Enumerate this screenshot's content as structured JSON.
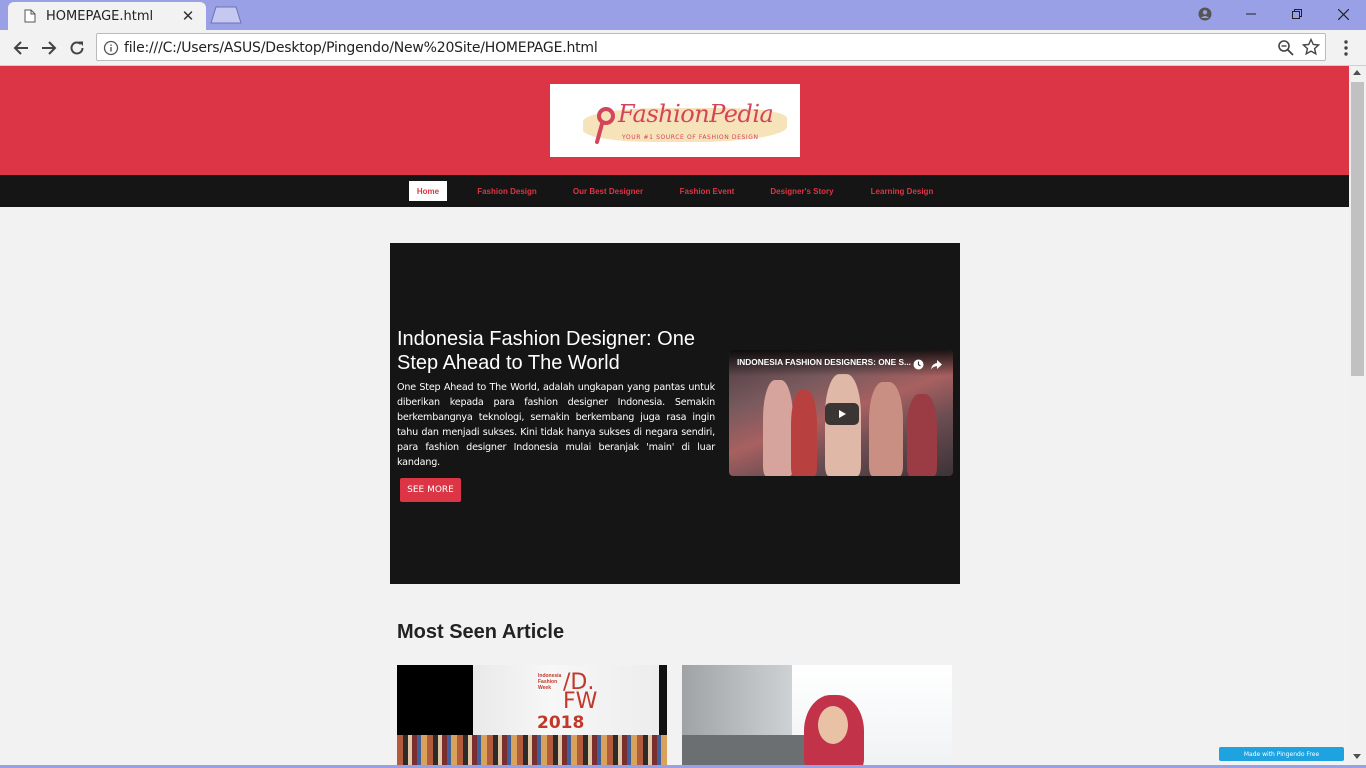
{
  "browser": {
    "tab_title": "HOMEPAGE.html",
    "url": "file:///C:/Users/ASUS/Desktop/Pingendo/New%20Site/HOMEPAGE.html"
  },
  "site": {
    "logo": {
      "name": "FashionPedia",
      "tagline": "YOUR #1 SOURCE OF FASHION DESIGN"
    },
    "nav": [
      {
        "label": "Home",
        "active": true
      },
      {
        "label": "Fashion Design",
        "active": false
      },
      {
        "label": "Our Best Designer",
        "active": false
      },
      {
        "label": "Fashion Event",
        "active": false
      },
      {
        "label": "Designer's Story",
        "active": false
      },
      {
        "label": "Learning Design",
        "active": false
      }
    ],
    "hero": {
      "title": "Indonesia Fashion Designer: One Step Ahead to The World",
      "text": "One Step Ahead to The World, adalah ungkapan yang pantas untuk diberikan kepada para fashion designer Indonesia. Semakin berkembangnya teknologi, semakin berkembang juga rasa ingin tahu dan menjadi sukses. Kini tidak hanya sukses di negara sendiri, para fashion designer Indonesia mulai beranjak 'main' di luar kandang.",
      "button_label": "SEE MORE",
      "video_title": "INDONESIA FASHION DESIGNERS: ONE S..."
    },
    "most_seen": {
      "title": "Most Seen Article",
      "card1_small": "Indonesia Fashion Week",
      "card1_big": "/D.",
      "card1_fw": "FW",
      "card1_year": "2018"
    },
    "badge": "Made with Pingendo Free"
  },
  "colors": {
    "brand_red": "#dc3545",
    "nav_dark": "#151515",
    "titlebar": "#9aa0e6",
    "badge_blue": "#1fa2e0"
  }
}
